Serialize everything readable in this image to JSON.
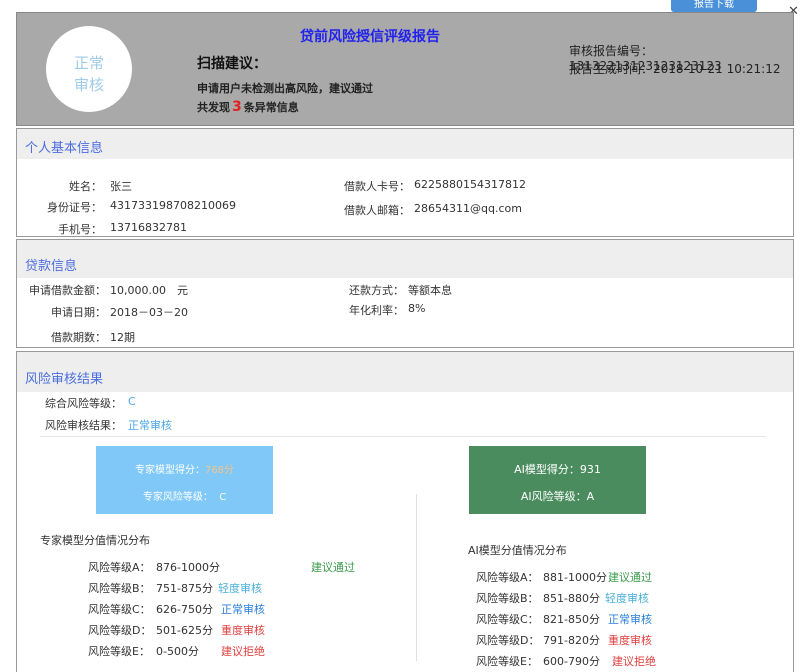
{
  "toolbar": {
    "download_label": "报告下载",
    "close_label": "✕"
  },
  "header": {
    "stamp_line1": "正常",
    "stamp_line2": "审核",
    "title": "贷前风险授信评级报告",
    "scan_title": "扫描建议：",
    "scan_text": "申请用户未检测出高风险，建议通过",
    "found_prefix": "共发现",
    "found_count": "3",
    "found_suffix": "条异常信息",
    "report_no_label": "审核报告编号：",
    "report_no": "13132213123123123123",
    "report_time_label": "报告生成时间：",
    "report_time": "2018-10-21 10:21:12"
  },
  "personal": {
    "title": "个人基本信息",
    "name_label": "姓名：",
    "name": "张三",
    "id_label": "身份证号：",
    "id": "431733198708210069",
    "phone_label": "手机号：",
    "phone": "13716832781",
    "card_label": "借款人卡号：",
    "card": "6225880154317812",
    "email_label": "借款人邮箱：",
    "email": "28654311@qq.com"
  },
  "loan": {
    "title": "贷款信息",
    "amount_label": "申请借款金额：",
    "amount": "10,000.00　元",
    "date_label": "申请日期：",
    "date": "2018－03－20",
    "periods_label": "借款期数：",
    "periods": "12期",
    "repay_label": "还款方式：",
    "repay": "等额本息",
    "rate_label": "年化利率：",
    "rate": "8%"
  },
  "risk": {
    "title": "风险审核结果",
    "level_label": "综合风险等级：",
    "level": "C",
    "result_label": "风险审核结果：",
    "result": "正常审核",
    "expert_card": {
      "score_label": "专家模型得分：",
      "score": "768分",
      "level_label": "专家风险等级：",
      "level": "C",
      "color": "#7fc8f8"
    },
    "ai_card": {
      "score_label": "AI模型得分：",
      "score": "931",
      "level_label": "AI风险等级：",
      "level": "A",
      "color": "#4a8c5e"
    },
    "expert_dist": {
      "title": "专家模型分值情况分布",
      "rows": [
        {
          "level": "风险等级A：",
          "range": "876-1000分",
          "advice": "建议通过"
        },
        {
          "level": "风险等级B：",
          "range": "751-875分",
          "advice": "轻度审核"
        },
        {
          "level": "风险等级C：",
          "range": "626-750分",
          "advice": "正常审核"
        },
        {
          "level": "风险等级D：",
          "range": "501-625分",
          "advice": "重度审核"
        },
        {
          "level": "风险等级E：",
          "range": "0-500分",
          "advice": "建议拒绝"
        }
      ]
    },
    "ai_dist": {
      "title": "AI模型分值情况分布",
      "rows": [
        {
          "level": "风险等级A：",
          "range": "881-1000分",
          "advice": "建议通过"
        },
        {
          "level": "风险等级B：",
          "range": "851-880分",
          "advice": "轻度审核"
        },
        {
          "level": "风险等级C：",
          "range": "821-850分",
          "advice": "正常审核"
        },
        {
          "level": "风险等级D：",
          "range": "791-820分",
          "advice": "重度审核"
        },
        {
          "level": "风险等级E：",
          "range": "600-790分",
          "advice": "建议拒绝"
        }
      ]
    }
  }
}
